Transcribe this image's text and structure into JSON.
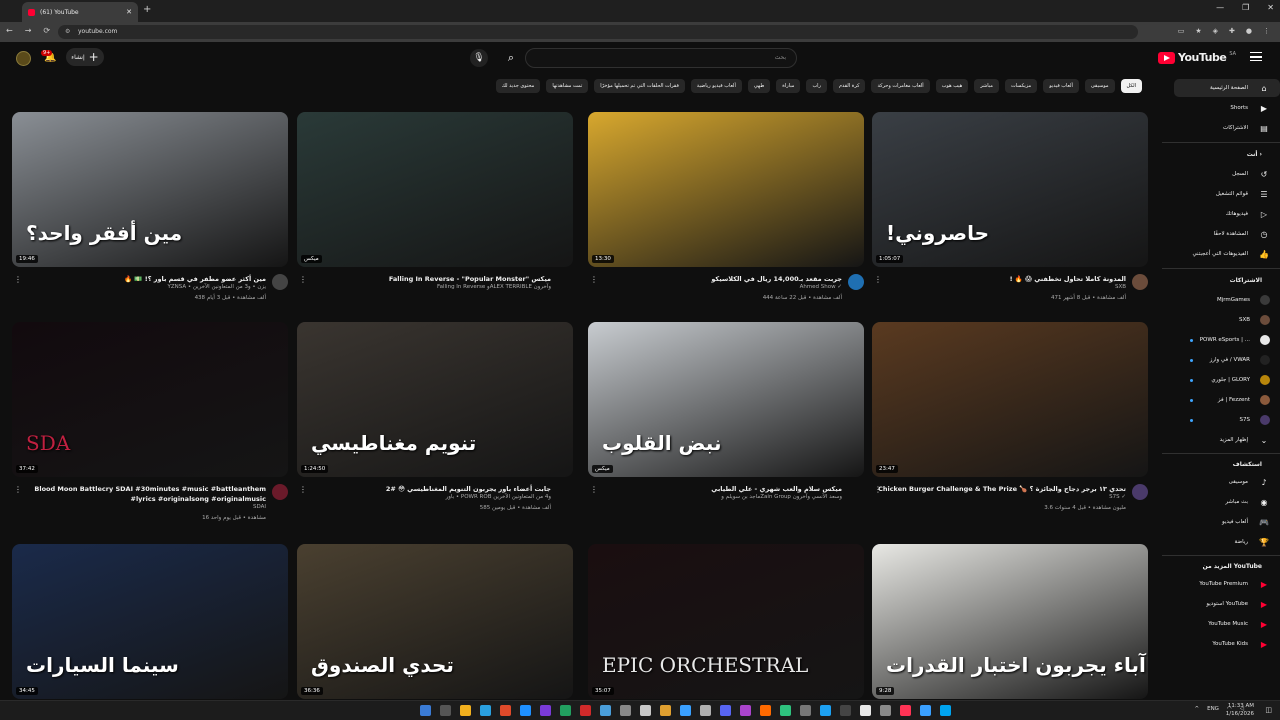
{
  "browser": {
    "tab_title": "(61) YouTube",
    "url": "youtube.com",
    "new_tab": "+",
    "window_controls": [
      "—",
      "❐",
      "✕"
    ]
  },
  "header": {
    "logo_text": "YouTube",
    "region": "SA",
    "search_placeholder": "بحث",
    "create_label": "إنشاء",
    "notification_count": "9+"
  },
  "chips": [
    {
      "label": "الكل",
      "active": true
    },
    {
      "label": "موسيقى"
    },
    {
      "label": "ألعاب فيديو"
    },
    {
      "label": "مزيكسات"
    },
    {
      "label": "مباشر"
    },
    {
      "label": "هيب هوب"
    },
    {
      "label": "ألعاب مغامرات وحركة"
    },
    {
      "label": "كرة القدم"
    },
    {
      "label": "راب"
    },
    {
      "label": "مباراة"
    },
    {
      "label": "طهي"
    },
    {
      "label": "ألعاب فيديو رياضية"
    },
    {
      "label": "فقرات الحلقات التي تم تحميلها مؤخرًا"
    },
    {
      "label": "تمت مشاهدتها"
    },
    {
      "label": "محتوى جديد لك"
    }
  ],
  "sidebar": {
    "main": [
      {
        "label": "الصفحة الرئيسية",
        "icon": "home-icon",
        "active": true
      },
      {
        "label": "Shorts",
        "icon": "shorts-icon"
      },
      {
        "label": "الاشتراكات",
        "icon": "subscriptions-icon"
      }
    ],
    "you_heading": "أنت  ›",
    "you": [
      {
        "label": "السجل",
        "icon": "history-icon"
      },
      {
        "label": "قوائم التشغيل",
        "icon": "playlist-icon"
      },
      {
        "label": "فيديوهاتك",
        "icon": "your-videos-icon"
      },
      {
        "label": "المشاهدة لاحقًا",
        "icon": "watch-later-icon"
      },
      {
        "label": "الفيديوهات التي أعجبتني",
        "icon": "like-icon"
      }
    ],
    "subs_heading": "الاشتراكات",
    "subs": [
      {
        "label": "MjrmGames",
        "color": "#3a3a3a",
        "dot": false
      },
      {
        "label": "SXB",
        "color": "#6b4c3b",
        "dot": false
      },
      {
        "label": "POWR eSports | ...",
        "color": "#e8e8e8",
        "dot": true
      },
      {
        "label": "في وارز / VWAR",
        "color": "#222222",
        "dot": true
      },
      {
        "label": "جلوري | GLORY",
        "color": "#b8860b",
        "dot": true
      },
      {
        "label": "فز | Fezzent",
        "color": "#8b5a3c",
        "dot": true
      },
      {
        "label": "S7S",
        "color": "#4a3a6a",
        "dot": true
      }
    ],
    "show_more": "إظهار المزيد",
    "explore_heading": "استكشاف",
    "explore": [
      {
        "label": "موسيقى",
        "icon": "music-icon"
      },
      {
        "label": "بث مباشر",
        "icon": "live-icon"
      },
      {
        "label": "ألعاب فيديو",
        "icon": "gaming-icon"
      },
      {
        "label": "رياضة",
        "icon": "trophy-icon"
      }
    ],
    "more_heading": "المزيد من YouTube",
    "more": [
      {
        "label": "YouTube Premium"
      },
      {
        "label": "استوديو YouTube"
      },
      {
        "label": "YouTube Music"
      },
      {
        "label": "YouTube Kids"
      }
    ]
  },
  "videos": [
    {
      "title": "المدونة كاملا تحاول تخطفني 😱 🔥 !",
      "channel": "SXB",
      "stats": "471 ألف مشاهدة • قبل 8 أشهر",
      "duration": "1:05:07",
      "thumb_text": "حاصروني!",
      "thumb_bg": "#3a3f45",
      "avatar": "#6b4c3b"
    },
    {
      "title": "جربت مقعد بـ14,000 ريال في الكلاسيكو",
      "channel": "Ahmed Show ✓",
      "stats": "444 ألف مشاهدة • قبل 22 ساعة",
      "duration": "13:30",
      "thumb_text": "",
      "thumb_bg": "#d8a82e",
      "avatar": "#1f6fb2"
    },
    {
      "title": "ميكس \"Falling In Reverse - \"Popular Monster",
      "channel": "Falling In Reverse وALEX TERRIBLE وآخرون",
      "stats": "",
      "duration": "ميكس",
      "thumb_text": "",
      "thumb_bg": "#2a3a38",
      "avatar": ""
    },
    {
      "title": "مين أكثر عضو مطفر في قسم باور ؟! 💵 🔥",
      "channel": "YZNSA • يزن • و3 من المتعاونين الآخرين",
      "stats": "438 ألف مشاهدة • قبل 3 أيام",
      "duration": "19:46",
      "thumb_text": "مين أفقر واحد؟",
      "thumb_bg": "#8a8f95",
      "avatar": "#444444"
    },
    {
      "title": "تحدي ١٣ برجر دجاج والجائزة ؟ 🍗 Chicken Burger Challenge & The Prize ؟",
      "channel": "S7S ✓",
      "stats": "3.6 مليون مشاهدة • قبل 4 سنوات",
      "duration": "23:47",
      "thumb_text": "",
      "thumb_bg": "#5a3a20",
      "avatar": "#4a3a6a"
    },
    {
      "title": "ميكس سلام والعب شهري - علي الطيابي",
      "channel": "ماجد بن سويلم وZain Group وسعد الأنسي وآخرون",
      "stats": "",
      "duration": "ميكس",
      "thumb_text": "نبض القلوب",
      "thumb_bg": "#c8ccd0",
      "avatar": ""
    },
    {
      "title": "جابت أعضاء باور يجربون التنويم المغناطيسي 😳 #2",
      "channel": "باور • POWR ROB و4 من المتعاونين الآخرين",
      "stats": "585 ألف مشاهدة • قبل يومين",
      "duration": "1:24:50",
      "thumb_text": "تنويم مغناطيسي",
      "thumb_bg": "#3a3530",
      "avatar": ""
    },
    {
      "title": "Blood Moon Battlecry SDAI #30minutes #music #battleanthem #lyrics #originalsong #originalmusic",
      "channel": "SDAI",
      "stats": "16 مشاهدة • قبل يوم واحد",
      "duration": "37:42",
      "thumb_text": "SDA",
      "thumb_bg": "#120a0e",
      "avatar": "#6a1a2a"
    },
    {
      "title": "",
      "channel": "",
      "stats": "",
      "duration": "9:28",
      "thumb_text": "آباء يجربون اختبار القدرات",
      "thumb_bg": "#e8e8e4",
      "avatar": ""
    },
    {
      "title": "",
      "channel": "",
      "stats": "",
      "duration": "35:07",
      "thumb_text": "EPIC ORCHESTRAL",
      "thumb_bg": "#1a0e10",
      "avatar": ""
    },
    {
      "title": "",
      "channel": "",
      "stats": "",
      "duration": "36:36",
      "thumb_text": "تحدي الصندوق",
      "thumb_bg": "#4a4030",
      "avatar": ""
    },
    {
      "title": "",
      "channel": "",
      "stats": "",
      "duration": "34:45",
      "thumb_text": "سينما السيارات",
      "thumb_bg": "#1a2a4a",
      "avatar": ""
    }
  ],
  "taskbar": {
    "lang": "ENG",
    "time": "11:33 AM",
    "date": "1/16/2026"
  },
  "colors": {
    "bg": "#0f0f0f",
    "brand": "#ff0033",
    "chip": "#272727"
  }
}
